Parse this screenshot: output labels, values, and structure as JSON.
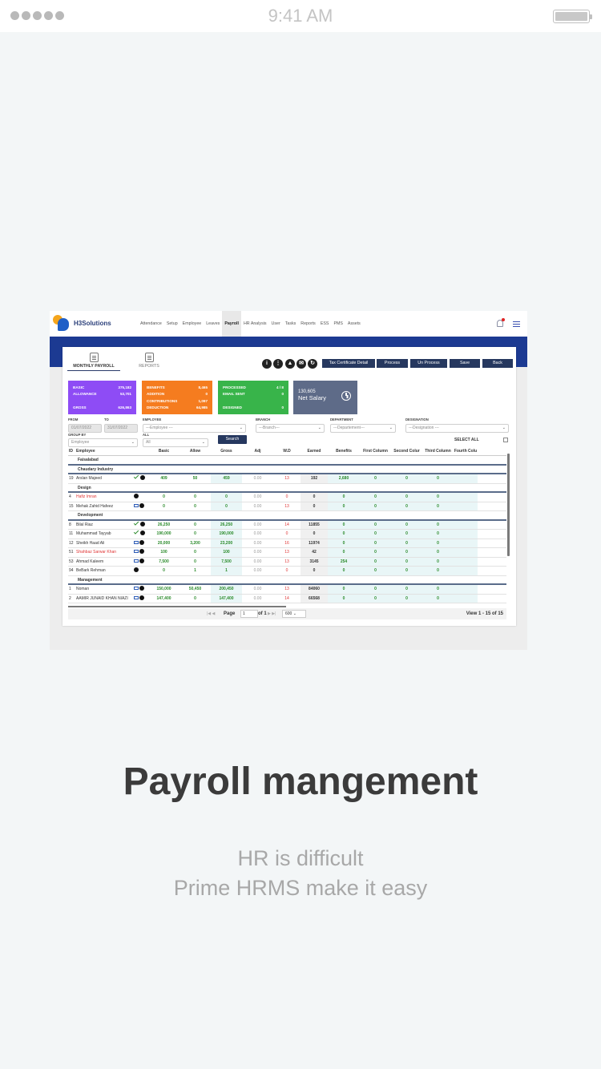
{
  "status_bar": {
    "time": "9:41 AM"
  },
  "app": {
    "brand": "H3Solutions",
    "menu": [
      "Attendance",
      "Setup",
      "Employee",
      "Leaves",
      "Payroll",
      "HR Analysis",
      "User",
      "Tasks",
      "Reports",
      "ESS",
      "PMS",
      "Assets"
    ],
    "active_menu": "Payroll",
    "tabs": [
      "MONTHLY PAYROLL",
      "REPORTS"
    ],
    "toolbar_buttons": [
      "Tax Certificate Detail",
      "Process",
      "Un Process",
      "Save",
      "Back"
    ],
    "summary": {
      "purple": [
        [
          "BASIC",
          "375,182"
        ],
        [
          "ALLOWANCE",
          "53,701"
        ],
        [
          "GROSS",
          "626,863"
        ]
      ],
      "orange": [
        [
          "BENEFITS",
          "8,465"
        ],
        [
          "ADDITION",
          "0"
        ],
        [
          "CONTRIBUTIONS",
          "1,097"
        ],
        [
          "DEDUCTION",
          "64,985"
        ]
      ],
      "green": [
        [
          "PROCESSED",
          "4 / 8"
        ],
        [
          "EMAIL SENT",
          "0"
        ],
        [
          "DESIGNED",
          "0"
        ]
      ],
      "net_salary_value": "130,605",
      "net_salary_label": "Net Salary"
    },
    "filters": {
      "from_label": "FROM",
      "from_value": "01/07/2022",
      "to_label": "TO",
      "to_value": "31/07/2022",
      "employee_label": "EMPLOYEE",
      "employee_value": "---Employee ---",
      "branch_label": "BRANCH",
      "branch_value": "---Branch---",
      "department_label": "DEPARTMENT",
      "department_value": "---Departement---",
      "designation_label": "DESIGNATION",
      "designation_value": "---Designation ---",
      "group_by_label": "GROUP BY",
      "group_by_value": "Employee",
      "all_label": "ALL",
      "all_value": "All",
      "search_label": "Search",
      "select_all_label": "SELECT ALL"
    },
    "table": {
      "headers": [
        "ID",
        "Employee",
        "Basic",
        "Allow",
        "Gross",
        "Adj",
        "W.D",
        "Earned",
        "Benefits",
        "First Column",
        "Second Colur",
        "Third Column",
        "Fourth Colu"
      ],
      "rows": [
        {
          "type": "group",
          "label": "Faisalabad"
        },
        {
          "type": "group",
          "label": "Chaudary Industry"
        },
        {
          "type": "row",
          "id": "19",
          "name": "Arslan Majeed",
          "icons": "check",
          "basic": "409",
          "allow": "50",
          "gross": "459",
          "adj": "0.00",
          "wd": "13",
          "earned": "192",
          "benefits": "2,680",
          "c1": "0",
          "c2": "0",
          "c3": "0",
          "c4": ""
        },
        {
          "type": "group",
          "label": "Design"
        },
        {
          "type": "row",
          "id": "4",
          "name": "Hafiz Imran",
          "red": true,
          "icons": "info",
          "basic": "0",
          "allow": "0",
          "gross": "0",
          "adj": "0.00",
          "wd": "0",
          "earned": "0",
          "benefits": "0",
          "c1": "0",
          "c2": "0",
          "c3": "0",
          "c4": ""
        },
        {
          "type": "row",
          "id": "15",
          "name": "Mehak Zahid Hafeez",
          "icons": "mail",
          "basic": "0",
          "allow": "0",
          "gross": "0",
          "adj": "0.00",
          "wd": "13",
          "earned": "0",
          "benefits": "0",
          "c1": "0",
          "c2": "0",
          "c3": "0",
          "c4": ""
        },
        {
          "type": "group",
          "label": "Development"
        },
        {
          "type": "row",
          "id": "8",
          "name": "Bilal Riaz",
          "icons": "check",
          "basic": "26,250",
          "allow": "0",
          "gross": "26,250",
          "adj": "0.00",
          "wd": "14",
          "earned": "11855",
          "benefits": "0",
          "c1": "0",
          "c2": "0",
          "c3": "0",
          "c4": ""
        },
        {
          "type": "row",
          "id": "11",
          "name": "Muhammad Tayyab",
          "icons": "check",
          "basic": "190,000",
          "allow": "0",
          "gross": "190,000",
          "adj": "0.00",
          "wd": "0",
          "earned": "0",
          "benefits": "0",
          "c1": "0",
          "c2": "0",
          "c3": "0",
          "c4": ""
        },
        {
          "type": "row",
          "id": "12",
          "name": "Sheikh Haad Ali",
          "icons": "mail",
          "basic": "20,000",
          "allow": "3,200",
          "gross": "23,200",
          "adj": "0.00",
          "wd": "16",
          "earned": "11974",
          "benefits": "0",
          "c1": "0",
          "c2": "0",
          "c3": "0",
          "c4": ""
        },
        {
          "type": "row",
          "id": "51",
          "name": "Shahbaz Sarwar Khan",
          "red": true,
          "icons": "mail",
          "basic": "100",
          "allow": "0",
          "gross": "100",
          "adj": "0.00",
          "wd": "13",
          "earned": "42",
          "benefits": "0",
          "c1": "0",
          "c2": "0",
          "c3": "0",
          "c4": ""
        },
        {
          "type": "row",
          "id": "53",
          "name": "Ahmad Kaleem",
          "icons": "mail",
          "basic": "7,500",
          "allow": "0",
          "gross": "7,500",
          "adj": "0.00",
          "wd": "13",
          "earned": "3145",
          "benefits": "254",
          "c1": "0",
          "c2": "0",
          "c3": "0",
          "c4": ""
        },
        {
          "type": "row",
          "id": "94",
          "name": "BeBark Rehman",
          "icons": "info",
          "basic": "0",
          "allow": "1",
          "gross": "1",
          "adj": "0.00",
          "wd": "0",
          "earned": "0",
          "benefits": "0",
          "c1": "0",
          "c2": "0",
          "c3": "0",
          "c4": ""
        },
        {
          "type": "group",
          "label": "Management"
        },
        {
          "type": "row",
          "id": "1",
          "name": "Noman",
          "icons": "mail",
          "basic": "150,000",
          "allow": "50,450",
          "gross": "200,450",
          "adj": "0.00",
          "wd": "13",
          "earned": "84060",
          "benefits": "0",
          "c1": "0",
          "c2": "0",
          "c3": "0",
          "c4": ""
        },
        {
          "type": "row",
          "id": "2",
          "name": "AAMIR JUNAID KHAN NIAZI",
          "icons": "mail",
          "basic": "147,400",
          "allow": "0",
          "gross": "147,400",
          "adj": "0.00",
          "wd": "14",
          "earned": "66568",
          "benefits": "0",
          "c1": "0",
          "c2": "0",
          "c3": "0",
          "c4": ""
        }
      ]
    },
    "pager": {
      "page_label": "Page",
      "page_value": "1",
      "of_label": "of 1",
      "page_size": "600",
      "view_text": "View 1 - 15 of 15"
    }
  },
  "headline": "Payroll mangement",
  "subline_1": "HR is difficult",
  "subline_2": "Prime HRMS make it easy",
  "colors": {
    "accent_blue": "#1c3a92",
    "button_navy": "#26385f",
    "purple": "#8e4cf5",
    "orange": "#f57c1f",
    "green": "#38b44a",
    "slate": "#5e6b88"
  }
}
